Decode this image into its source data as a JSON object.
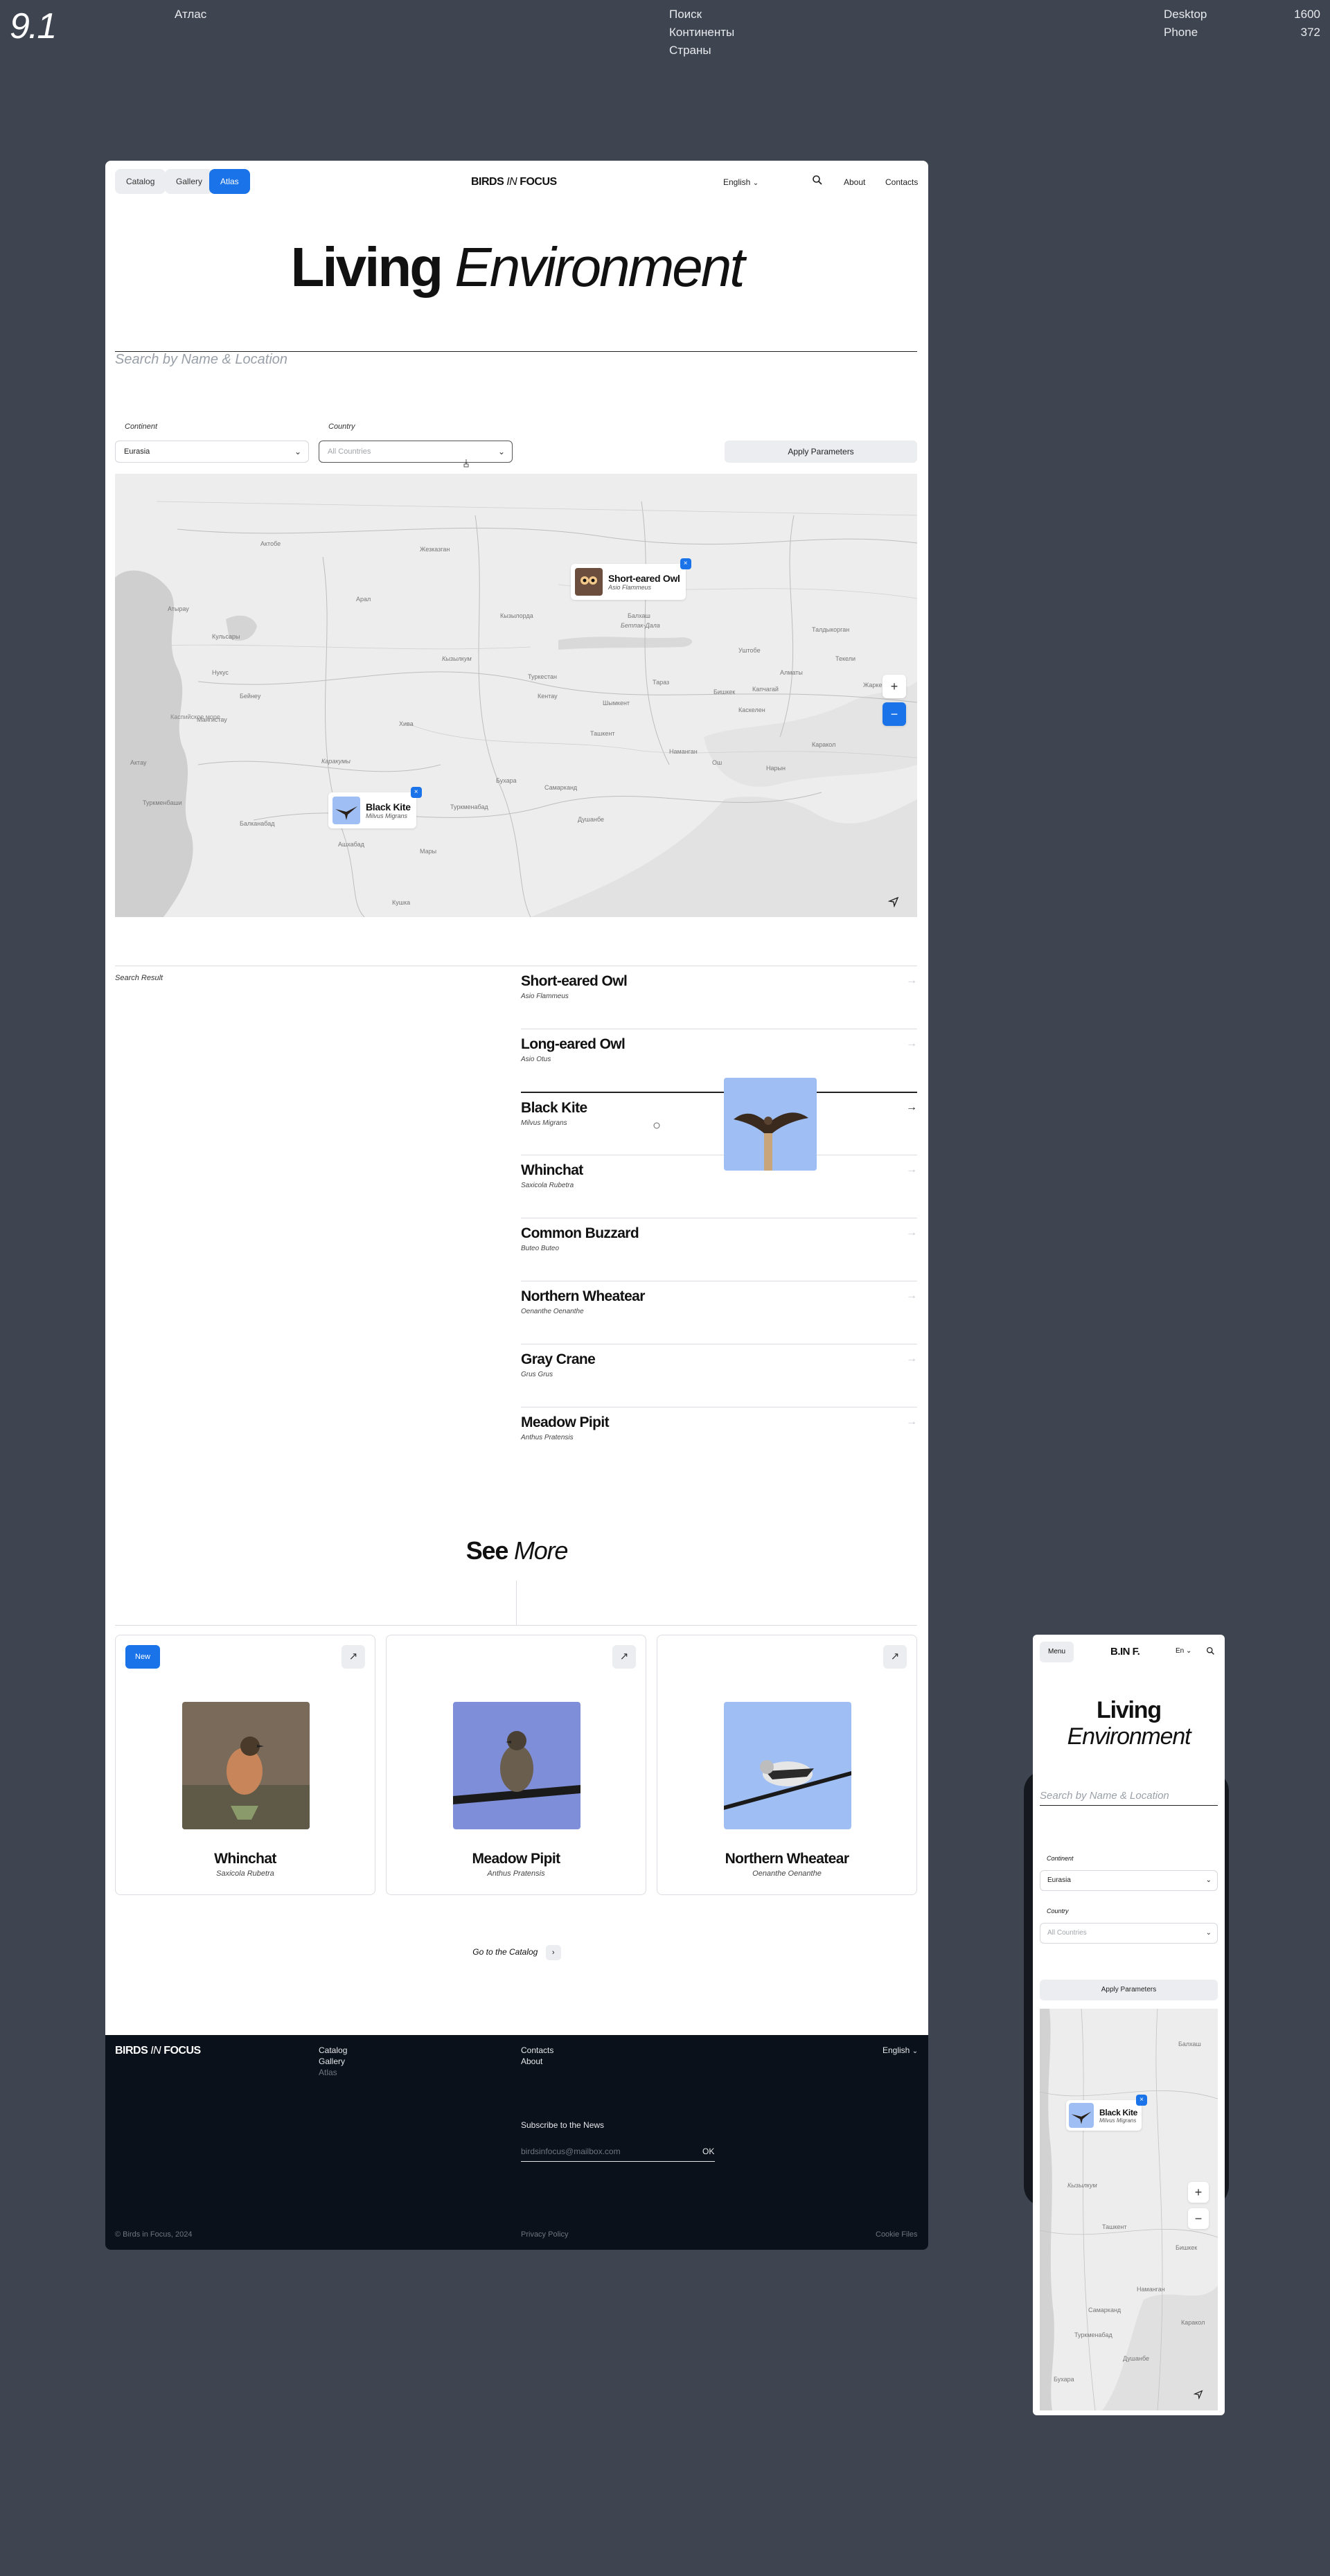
{
  "presentation": {
    "section_number": "9.1",
    "title": "Атлас",
    "topics": [
      "Поиск",
      "Континенты",
      "Страны"
    ],
    "viewports": [
      {
        "label": "Desktop",
        "width": "1600"
      },
      {
        "label": "Phone",
        "width": "372"
      }
    ]
  },
  "desktop": {
    "nav": {
      "tabs": [
        {
          "label": "Catalog",
          "active": false
        },
        {
          "label": "Gallery",
          "active": false
        },
        {
          "label": "Atlas",
          "active": true
        }
      ],
      "brand": {
        "left": "BIRDS",
        "mid": "IN",
        "right": "FOCUS"
      },
      "language": "English",
      "links": [
        "About",
        "Contacts"
      ]
    },
    "hero": {
      "title_bold": "Living",
      "title_italic": "Environment"
    },
    "search": {
      "placeholder": "Search by Name & Location"
    },
    "filters": {
      "continent_label": "Continent",
      "continent_value": "Eurasia",
      "country_label": "Country",
      "country_placeholder": "All Countries",
      "apply_label": "Apply Parameters"
    },
    "map": {
      "labels": [
        "Каспийское море",
        "Кызылкум",
        "Каракумы",
        "Балхаш",
        "Бетпак-Дала",
        "Ташкент",
        "Бишкек",
        "Алматы",
        "Нукус",
        "Ашхабад",
        "Душанбе",
        "Мары",
        "Самарканд",
        "Бухара",
        "Хива",
        "Наманган",
        "Ош",
        "Туркменабад",
        "Кызылорда",
        "Шымкент",
        "Тараз",
        "Актобе",
        "Атырау",
        "Жезказган",
        "Кульсары",
        "Бейнеу",
        "Актау",
        "Мангистау",
        "Туркменбаши",
        "Балканабад",
        "Кушка",
        "Каракол",
        "Нарын",
        "Талдыкорган",
        "Уштобе",
        "Капчагай",
        "Каскелен",
        "Текели",
        "Жаркент",
        "Кентау",
        "Туркестан",
        "Арал"
      ],
      "markers": [
        {
          "name": "Short-eared Owl",
          "latin": "Asio Flammeus",
          "close": "×"
        },
        {
          "name": "Black Kite",
          "latin": "Milvus Migrans",
          "close": "×"
        }
      ],
      "zoom_in": "+",
      "zoom_out": "−",
      "locate_icon": "navigation-arrow-icon"
    },
    "results": {
      "label": "Search Result",
      "items": [
        {
          "name": "Short-eared Owl",
          "latin": "Asio Flammeus"
        },
        {
          "name": "Long-eared Owl",
          "latin": "Asio Otus"
        },
        {
          "name": "Black Kite",
          "latin": "Milvus Migrans"
        },
        {
          "name": "Whinchat",
          "latin": "Saxicola Rubetra"
        },
        {
          "name": "Common Buzzard",
          "latin": "Buteo Buteo"
        },
        {
          "name": "Northern Wheatear",
          "latin": "Oenanthe Oenanthe"
        },
        {
          "name": "Gray Crane",
          "latin": "Grus Grus"
        },
        {
          "name": "Meadow Pipit",
          "latin": "Anthus Pratensis"
        }
      ],
      "arrow": "→"
    },
    "see_more": {
      "title_bold": "See",
      "title_italic": "More",
      "cards": [
        {
          "badge": "New",
          "name": "Whinchat",
          "latin": "Saxicola Rubetra"
        },
        {
          "badge": "",
          "name": "Meadow Pipit",
          "latin": "Anthus Pratensis"
        },
        {
          "badge": "",
          "name": "Northern Wheatear",
          "latin": "Oenanthe Oenanthe"
        }
      ],
      "external_icon": "↗",
      "goto_label": "Go to the Catalog",
      "goto_chevron": "›"
    },
    "footer": {
      "col1": [
        "Catalog",
        "Gallery",
        "Atlas"
      ],
      "col2": [
        "Contacts",
        "About"
      ],
      "language": "English",
      "subscribe_label": "Subscribe to the News",
      "email_placeholder": "birdsinfocus@mailbox.com",
      "ok_label": "OK",
      "copyright": "© Birds in Focus, 2024",
      "privacy": "Privacy Policy",
      "cookie": "Cookie Files"
    }
  },
  "phone": {
    "menu_label": "Menu",
    "brand": "B.IN F.",
    "language": "En",
    "title_bold": "Living",
    "title_italic": "Environment",
    "search_placeholder": "Search by Name & Location",
    "continent_label": "Continent",
    "continent_value": "Eurasia",
    "country_label": "Country",
    "country_placeholder": "All Countries",
    "apply_label": "Apply Parameters",
    "map_labels": [
      "Кызылкум",
      "Ташкент",
      "Бишкек",
      "Самарканд",
      "Туркменабад",
      "Каракол",
      "Балхаш",
      "Наманган",
      "Душанбе",
      "Бухара"
    ],
    "marker": {
      "name": "Black Kite",
      "latin": "Milvus Migrans",
      "close": "×"
    },
    "zoom_in": "+",
    "zoom_out": "−"
  },
  "colors": {
    "accent": "#1a73e8",
    "backdrop": "#3e4550",
    "footer": "#0a111a",
    "pill": "#ebedf0"
  }
}
